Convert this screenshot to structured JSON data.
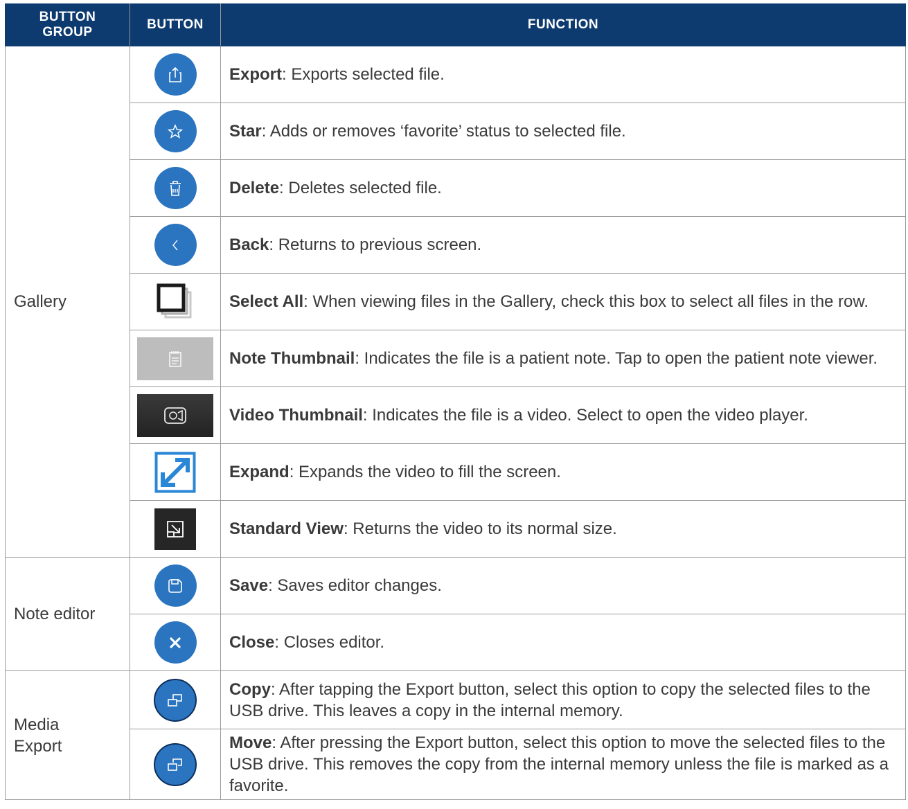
{
  "headers": {
    "group": "BUTTON\nGROUP",
    "group_l1": "BUTTON",
    "group_l2": "GROUP",
    "button": "BUTTON",
    "function": "FUNCTION"
  },
  "groups": [
    {
      "name": "Gallery"
    },
    {
      "name": "Note editor"
    },
    {
      "name": "Media\nExport",
      "l1": "Media",
      "l2": "Export"
    }
  ],
  "rows": [
    {
      "icon": "export-icon",
      "name": "Export",
      "desc": ": Exports selected file."
    },
    {
      "icon": "star-icon",
      "name": "Star",
      "desc": ": Adds or removes ‘favorite’ status to selected file."
    },
    {
      "icon": "trash-icon",
      "name": "Delete",
      "desc": ": Deletes selected file."
    },
    {
      "icon": "chevron-left-icon",
      "name": "Back",
      "desc": ": Returns to previous screen."
    },
    {
      "icon": "select-all-icon",
      "name": "Select All",
      "desc": ": When viewing files in the Gallery, check this box to select all files in the row."
    },
    {
      "icon": "note-thumbnail-icon",
      "name": "Note Thumbnail",
      "desc": ": Indicates the file is a patient note. Tap to open the patient note viewer."
    },
    {
      "icon": "video-thumbnail-icon",
      "name": "Video Thumbnail",
      "desc": ": Indicates the file is a video. Select to open the video player."
    },
    {
      "icon": "expand-icon",
      "name": "Expand",
      "desc": ": Expands the video to fill the screen."
    },
    {
      "icon": "standard-view-icon",
      "name": "Standard View",
      "desc": ": Returns the video to its normal size."
    },
    {
      "icon": "save-icon",
      "name": "Save",
      "desc": ": Saves editor changes."
    },
    {
      "icon": "close-icon",
      "name": "Close",
      "desc": ": Closes editor."
    },
    {
      "icon": "copy-icon",
      "name": "Copy",
      "desc": ": After tapping the Export button, select this option to copy the selected files to the USB drive. This leaves a copy in the internal memory."
    },
    {
      "icon": "move-icon",
      "name": "Move",
      "desc": ": After pressing the Export button, select this option to move the selected files to the USB drive. This removes the copy from the internal memory unless the file is marked as a favorite."
    }
  ],
  "colors": {
    "header_bg": "#0d3b6f",
    "button_blue": "#2a74c0",
    "border": "#9a9a9a"
  }
}
